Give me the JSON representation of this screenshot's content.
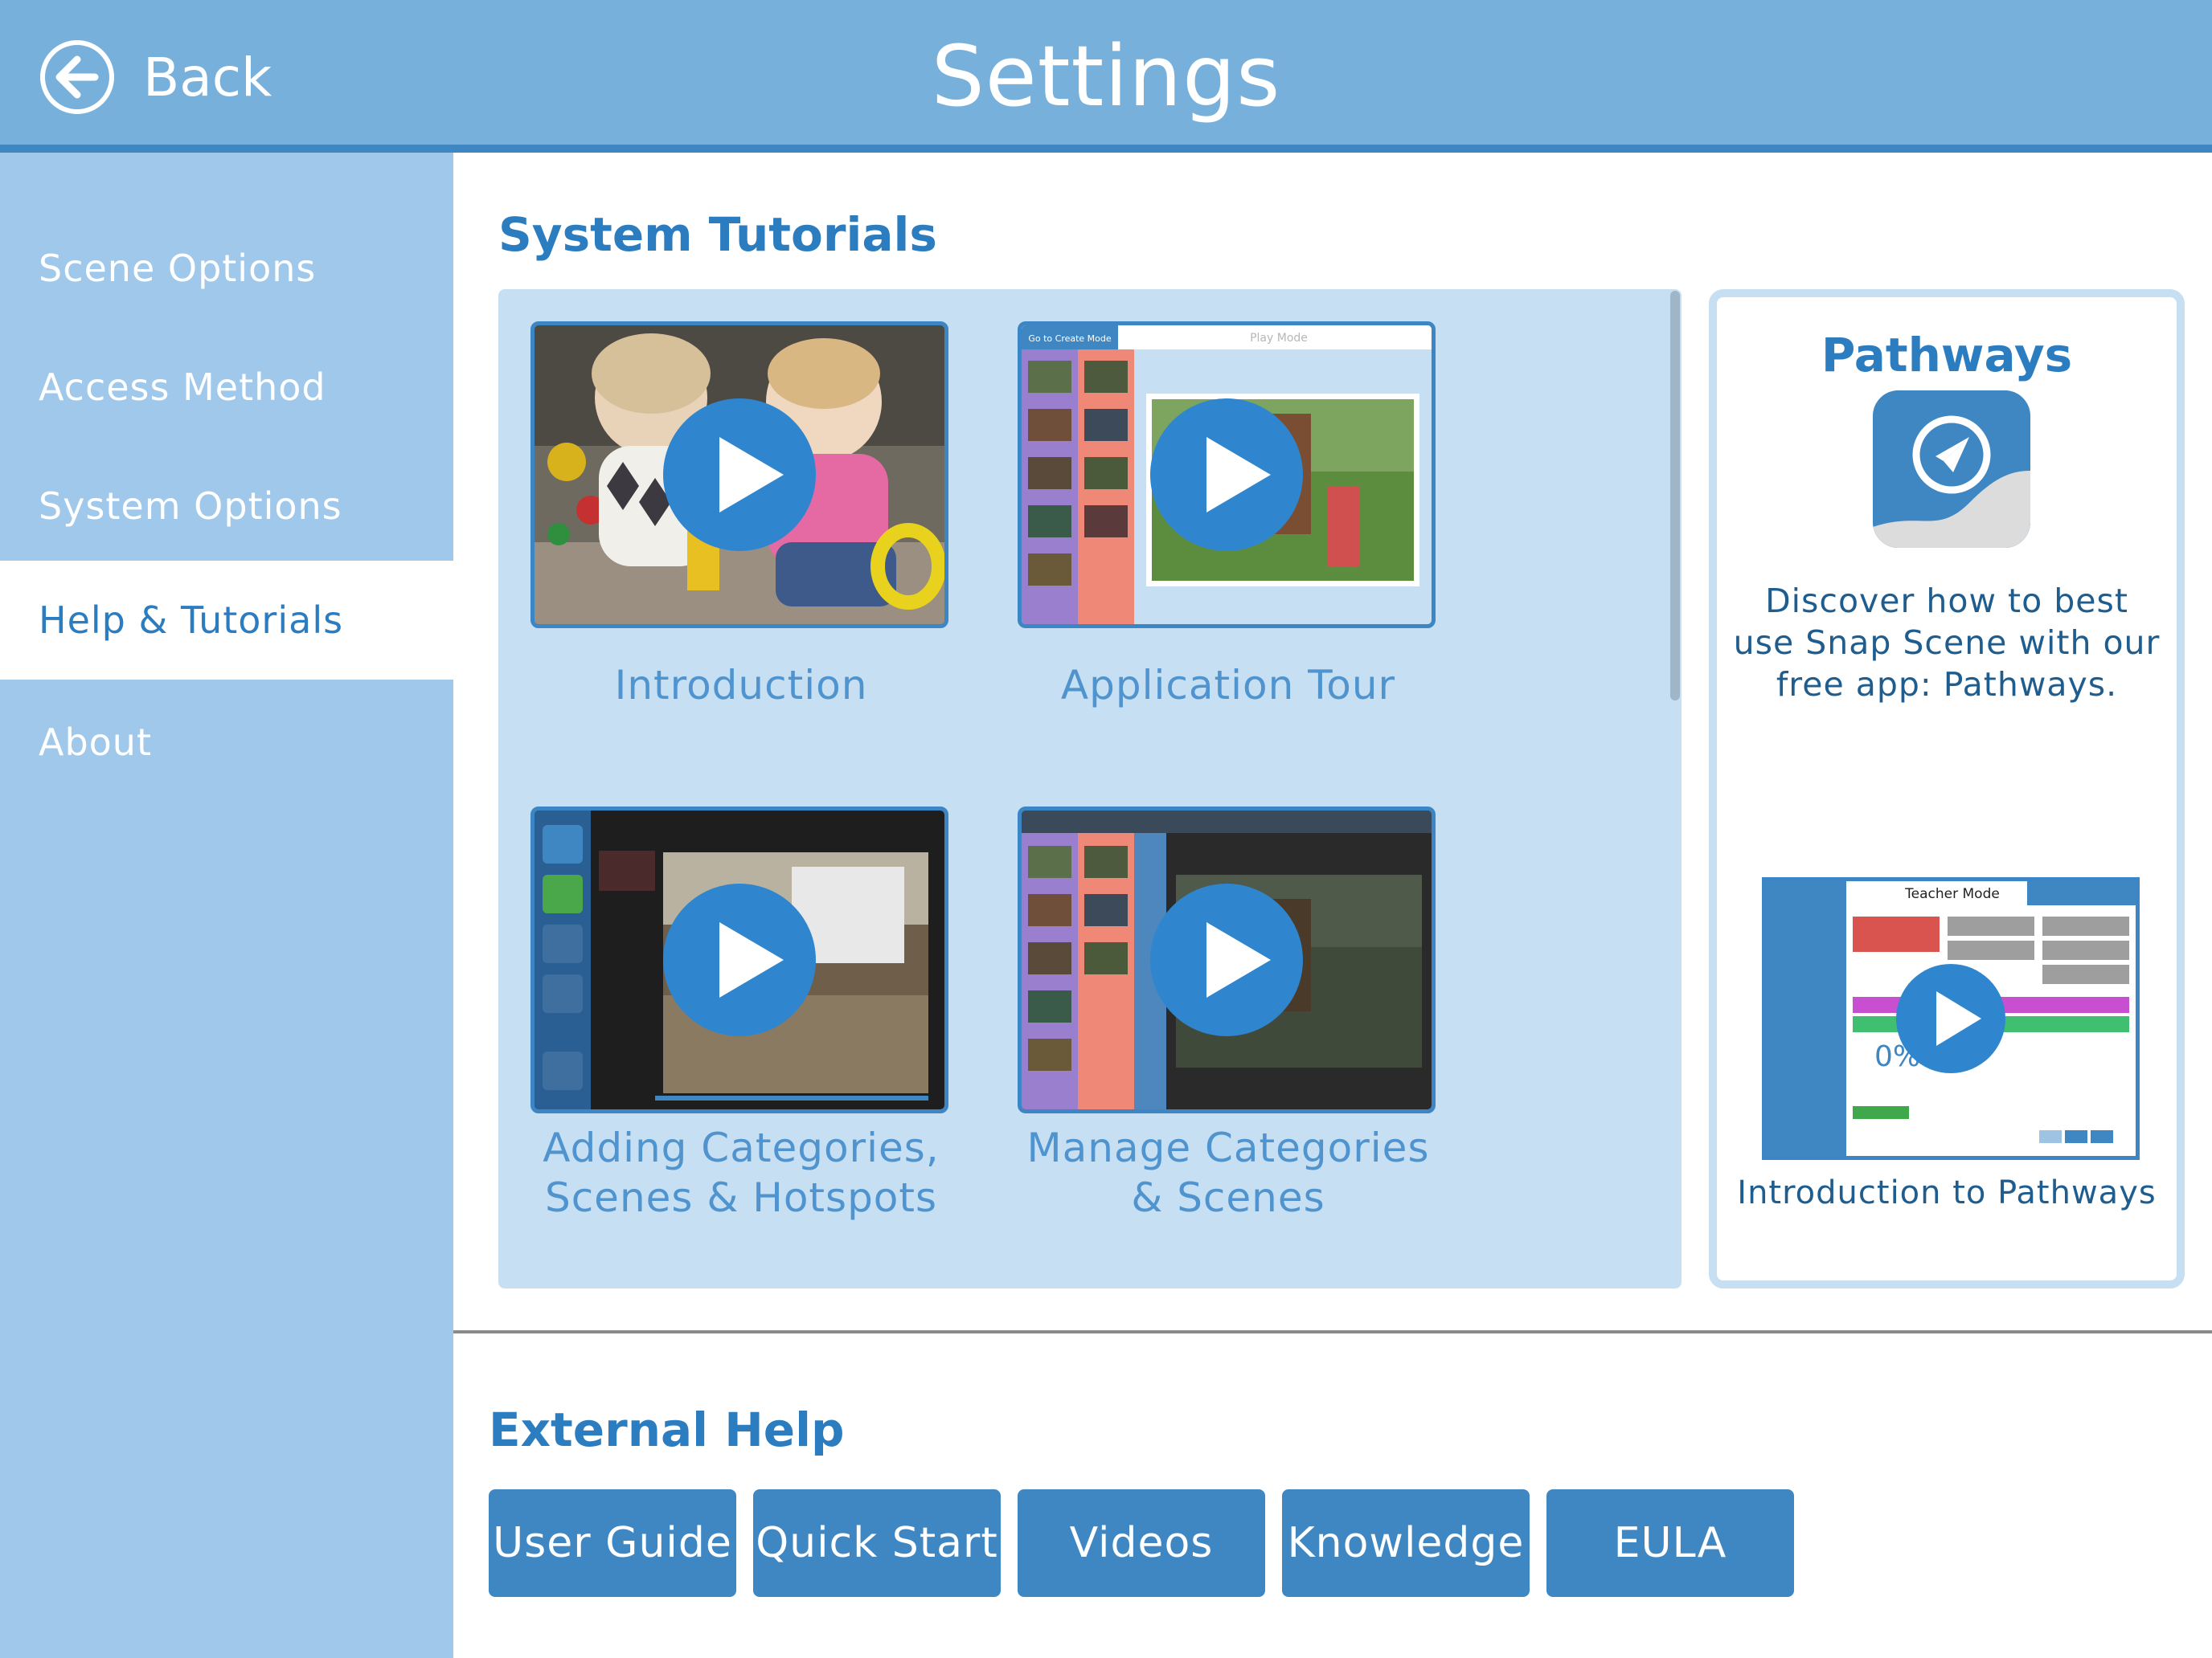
{
  "header": {
    "back_label": "Back",
    "title": "Settings"
  },
  "sidebar": {
    "items": [
      {
        "label": "Scene Options",
        "active": false
      },
      {
        "label": "Access Method",
        "active": false
      },
      {
        "label": "System Options",
        "active": false
      },
      {
        "label": "Help & Tutorials",
        "active": true
      },
      {
        "label": "About",
        "active": false
      }
    ]
  },
  "system_tutorials": {
    "title": "System Tutorials",
    "videos": [
      {
        "label_lines": [
          "Introduction"
        ]
      },
      {
        "label_lines": [
          "Application Tour"
        ],
        "thumb_text": [
          "Go to Create Mode",
          "Play Mode"
        ]
      },
      {
        "label_lines": [
          "Adding Categories,",
          "Scenes & Hotspots"
        ]
      },
      {
        "label_lines": [
          "Manage Categories",
          "& Scenes"
        ]
      }
    ]
  },
  "pathways": {
    "title": "Pathways",
    "description": "Discover how to best use Snap Scene with our free app: Pathways.",
    "video_label": "Introduction to Pathways",
    "thumb_text": {
      "mode": "Teacher Mode",
      "percent": "0%"
    }
  },
  "external_help": {
    "title": "External Help",
    "buttons": [
      "User Guide",
      "Quick Start",
      "Videos",
      "Knowledge",
      "EULA"
    ]
  },
  "colors": {
    "header_bg": "#78b0dc",
    "sidebar_bg": "#9fc8ea",
    "accent": "#3f87c3",
    "panel_bg": "#c7dff2",
    "heading_text": "#2c7cc0"
  },
  "icons": [
    "back-arrow-icon",
    "play-icon",
    "compass-icon"
  ]
}
